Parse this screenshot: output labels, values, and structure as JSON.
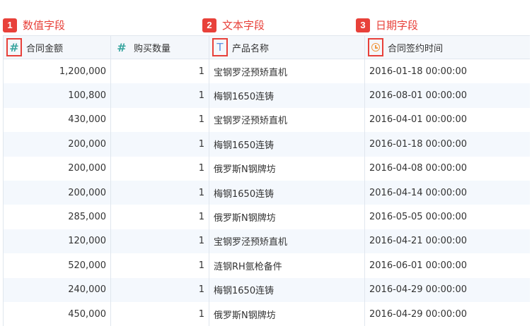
{
  "callouts": [
    {
      "num": "1",
      "text": "数值字段"
    },
    {
      "num": "2",
      "text": "文本字段"
    },
    {
      "num": "3",
      "text": "日期字段"
    }
  ],
  "columns": [
    {
      "icon": "#",
      "label": "合同金额"
    },
    {
      "icon": "#",
      "label": "购买数量"
    },
    {
      "icon": "T",
      "label": "产品名称"
    },
    {
      "icon": "",
      "label": "合同签约时间"
    }
  ],
  "rows": [
    [
      "1,200,000",
      "1",
      "宝钢罗泾预矫直机",
      "2016-01-18 00:00:00"
    ],
    [
      "100,800",
      "1",
      "梅钢1650连铸",
      "2016-08-01 00:00:00"
    ],
    [
      "430,000",
      "1",
      "宝钢罗泾预矫直机",
      "2016-04-01 00:00:00"
    ],
    [
      "200,000",
      "1",
      "梅钢1650连铸",
      "2016-01-18 00:00:00"
    ],
    [
      "200,000",
      "1",
      "俄罗斯N钢牌坊",
      "2016-04-08 00:00:00"
    ],
    [
      "200,000",
      "1",
      "梅钢1650连铸",
      "2016-04-14 00:00:00"
    ],
    [
      "285,000",
      "1",
      "俄罗斯N钢牌坊",
      "2016-05-05 00:00:00"
    ],
    [
      "120,000",
      "1",
      "宝钢罗泾预矫直机",
      "2016-04-21 00:00:00"
    ],
    [
      "520,000",
      "1",
      "涟钢RH氩枪备件",
      "2016-06-01 00:00:00"
    ],
    [
      "240,000",
      "1",
      "梅钢1650连铸",
      "2016-04-29 00:00:00"
    ],
    [
      "450,000",
      "1",
      "俄罗斯N钢牌坊",
      "2016-04-29 00:00:00"
    ]
  ]
}
